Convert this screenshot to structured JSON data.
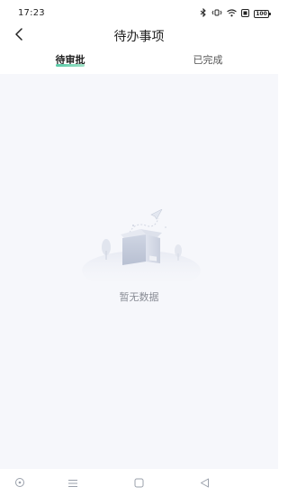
{
  "status_bar": {
    "time": "17:23",
    "icons": [
      "bluetooth-icon",
      "vibrate-icon",
      "wifi-icon",
      "sim-icon"
    ],
    "battery_level": "100"
  },
  "header": {
    "title": "待办事项",
    "back_icon": "chevron-left-icon"
  },
  "tabs": [
    {
      "label": "待审批",
      "active": true
    },
    {
      "label": "已完成",
      "active": false
    }
  ],
  "empty_state": {
    "illustration": "empty-box-illustration",
    "text": "暂无数据"
  },
  "system_nav": {
    "buttons": [
      "circle-icon",
      "menu-icon",
      "square-icon",
      "triangle-back-icon"
    ]
  },
  "colors": {
    "accent": "#57c9a6",
    "background": "#f6f7fb",
    "text_muted": "#8a8d96"
  }
}
